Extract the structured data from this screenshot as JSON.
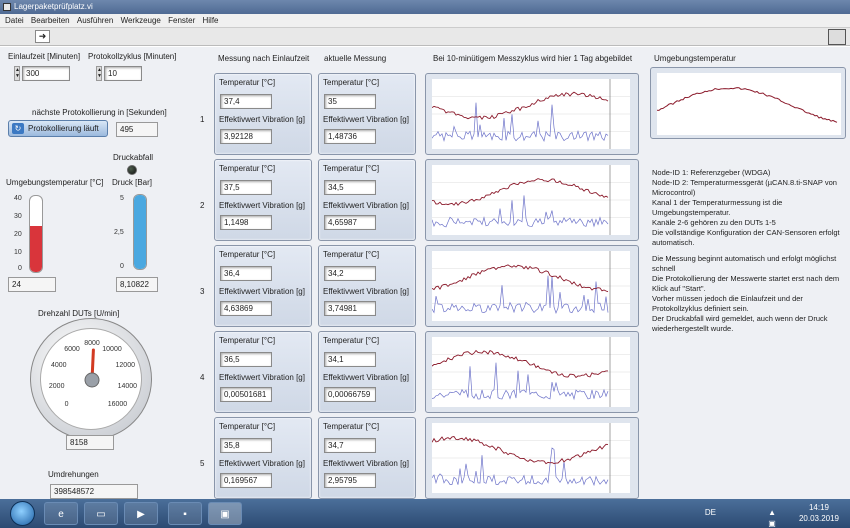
{
  "window": {
    "title": "Lagerpaketprüfplatz.vi"
  },
  "menu": [
    "Datei",
    "Bearbeiten",
    "Ausführen",
    "Werkzeuge",
    "Fenster",
    "Hilfe"
  ],
  "controls": {
    "einlaufzeit_label": "Einlaufzeit [Minuten]",
    "einlaufzeit_value": "300",
    "protokollzyklus_label": "Protokollzyklus [Minuten]",
    "protokollzyklus_value": "10",
    "naechste_label": "nächste Protokollierung in [Sekunden]",
    "naechste_value": "495",
    "proto_button": "Protokollierung läuft"
  },
  "umgebung": {
    "label": "Umgebungstemperatur [°C]",
    "ticks": [
      "40",
      "30",
      "20",
      "10",
      "0"
    ],
    "value": "24",
    "level": 0.6
  },
  "druck": {
    "abfall_label": "Druckabfall",
    "label": "Druck [Bar]",
    "ticks": [
      "5",
      "2,5",
      "0"
    ],
    "value": "8,10822",
    "level": 1.0
  },
  "drehzahl": {
    "label": "Drehzahl DUTs [U/min]",
    "ticks": [
      "0",
      "2000",
      "4000",
      "6000",
      "8000",
      "10000",
      "12000",
      "14000",
      "16000"
    ],
    "value": "8158",
    "needle_value": 8158
  },
  "umdrehungen": {
    "label": "Umdrehungen",
    "value": "398548572"
  },
  "headers": {
    "einlauf": "Messung nach Einlaufzeit",
    "aktuell": "aktuelle Messung",
    "chart": "Bei 10-minütigem Messzyklus wird hier 1 Tag abgebildet",
    "umgebung_chart": "Umgebungstemperatur"
  },
  "card_labels": {
    "temp": "Temperatur [°C]",
    "vib": "Effektivwert Vibration [g]"
  },
  "rows": [
    {
      "num": "1",
      "ein_temp": "37,4",
      "ein_vib": "3,92128",
      "akt_temp": "35",
      "akt_vib": "1,48736"
    },
    {
      "num": "2",
      "ein_temp": "37,5",
      "ein_vib": "1,1498",
      "akt_temp": "34,5",
      "akt_vib": "4,65987"
    },
    {
      "num": "3",
      "ein_temp": "36,4",
      "ein_vib": "4,63869",
      "akt_temp": "34,2",
      "akt_vib": "3,74981"
    },
    {
      "num": "4",
      "ein_temp": "36,5",
      "ein_vib": "0,00501681",
      "akt_temp": "34,1",
      "akt_vib": "0,00066759"
    },
    {
      "num": "5",
      "ein_temp": "35,8",
      "ein_vib": "0,169567",
      "akt_temp": "34,7",
      "akt_vib": "2,95795"
    }
  ],
  "notes": [
    "Node-ID 1: Referenzgeber (WDGA)",
    "Node-ID 2: Temperaturmessgerät (µCAN.8.ti-SNAP von Microcontrol)",
    "Kanal 1 der Temperaturmessung ist die Umgebungstemperatur.",
    "Kanäle 2-6 gehören zu den DUTs 1-5",
    "Die vollständige Konfiguration der CAN-Sensoren erfolgt automatisch.",
    "",
    "Die Messung beginnt automatisch und erfolgt möglichst schnell",
    "Die Protokollierung der Messwerte startet erst nach dem Klick auf \"Start\".",
    "Vorher müssen jedoch die Einlaufzeit und der Protokollzyklus definiert sein.",
    "Der Druckabfall wird gemeldet, auch wenn der Druck wiederhergestellt wurde."
  ],
  "colors": {
    "temp_series": "#8b1a2b",
    "vib_series": "#6d73c9",
    "thermo_fill": "#d9353b",
    "pressure_fill": "#4aa8e0",
    "needle": "#d23a22"
  },
  "taskbar": {
    "lang": "DE",
    "time": "14:19",
    "date": "20.03.2019"
  }
}
